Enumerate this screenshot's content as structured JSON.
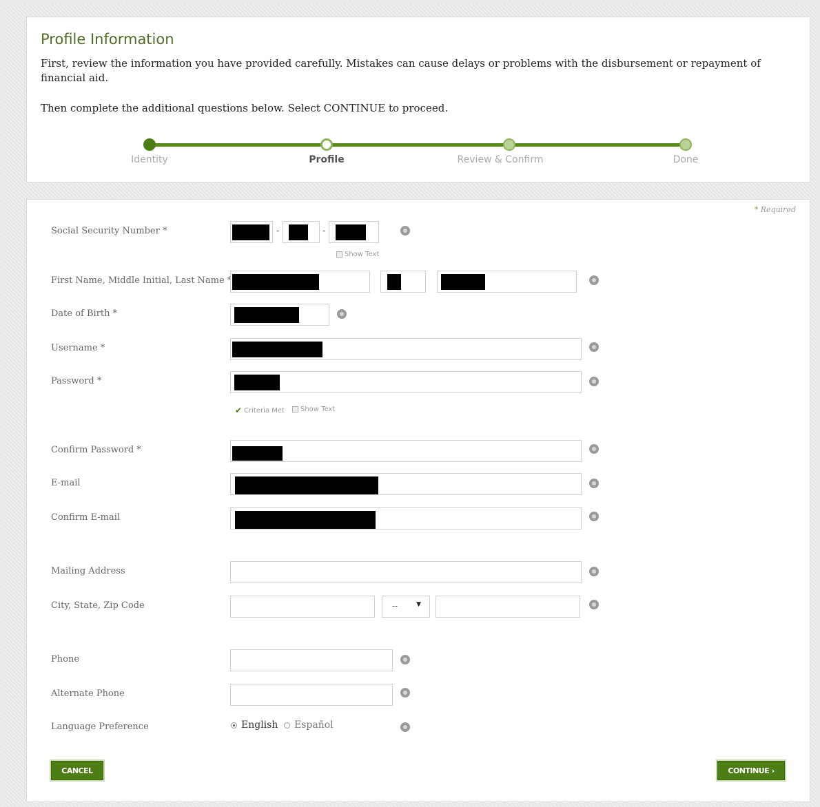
{
  "header": {
    "title": "Profile Information",
    "intro": "First, review the information you have provided carefully. Mistakes can cause delays or problems with the disbursement or repayment of financial aid.",
    "intro2": "Then complete the additional questions below. Select CONTINUE to proceed."
  },
  "progress": {
    "steps": [
      "Identity",
      "Profile",
      "Review & Confirm",
      "Done"
    ],
    "current_index": 1
  },
  "form": {
    "required_note": "Required",
    "required_star": "*",
    "ssn_label": "Social Security Number *",
    "ssn_dash": "-",
    "show_text": "Show Text",
    "name_label": "First Name, Middle Initial, Last Name *",
    "dob_label": "Date of Birth *",
    "username_label": "Username *",
    "password_label": "Password *",
    "criteria_met": "Criteria Met",
    "confirm_password_label": "Confirm Password *",
    "email_label": "E-mail",
    "confirm_email_label": "Confirm E-mail",
    "mailing_address_label": "Mailing Address",
    "mailing_address_value": "",
    "city_state_zip_label": "City, State, Zip Code",
    "city_value": "",
    "state_value": "--",
    "zip_value": "",
    "phone_label": "Phone",
    "phone_value": "",
    "alt_phone_label": "Alternate Phone",
    "alt_phone_value": "",
    "language_label": "Language Preference",
    "language_options": [
      "English",
      "Español"
    ],
    "language_selected": "English"
  },
  "buttons": {
    "cancel": "CANCEL",
    "continue": "CONTINUE ›"
  },
  "colors": {
    "accent": "#4d7e14",
    "progress_track": "#5a8a1a",
    "title": "#4e6e26"
  }
}
